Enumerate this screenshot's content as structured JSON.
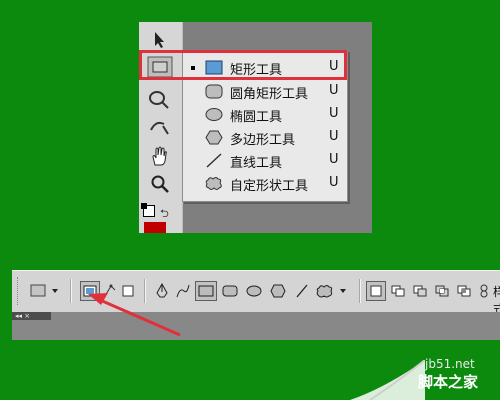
{
  "flyout": {
    "items": [
      {
        "label": "矩形工具",
        "key": "U",
        "icon": "rectangle-icon",
        "selected": true
      },
      {
        "label": "圆角矩形工具",
        "key": "U",
        "icon": "rounded-rectangle-icon"
      },
      {
        "label": "椭圆工具",
        "key": "U",
        "icon": "ellipse-icon"
      },
      {
        "label": "多边形工具",
        "key": "U",
        "icon": "polygon-icon"
      },
      {
        "label": "直线工具",
        "key": "U",
        "icon": "line-icon"
      },
      {
        "label": "自定形状工具",
        "key": "U",
        "icon": "custom-shape-icon"
      }
    ]
  },
  "toolbar_icons": [
    "move-icon",
    "rectangle-tool-icon",
    "dodge-icon",
    "path-select-icon",
    "hand-icon",
    "zoom-icon"
  ],
  "options_bar": {
    "style_label": "样式",
    "panel_tab": "◂◂ ×"
  },
  "colors": {
    "background": "#0c8a0e",
    "highlight": "#e0303b",
    "foreground_color": "#c00000"
  },
  "watermark": {
    "site": "jb51.net",
    "name": "脚本之家"
  }
}
